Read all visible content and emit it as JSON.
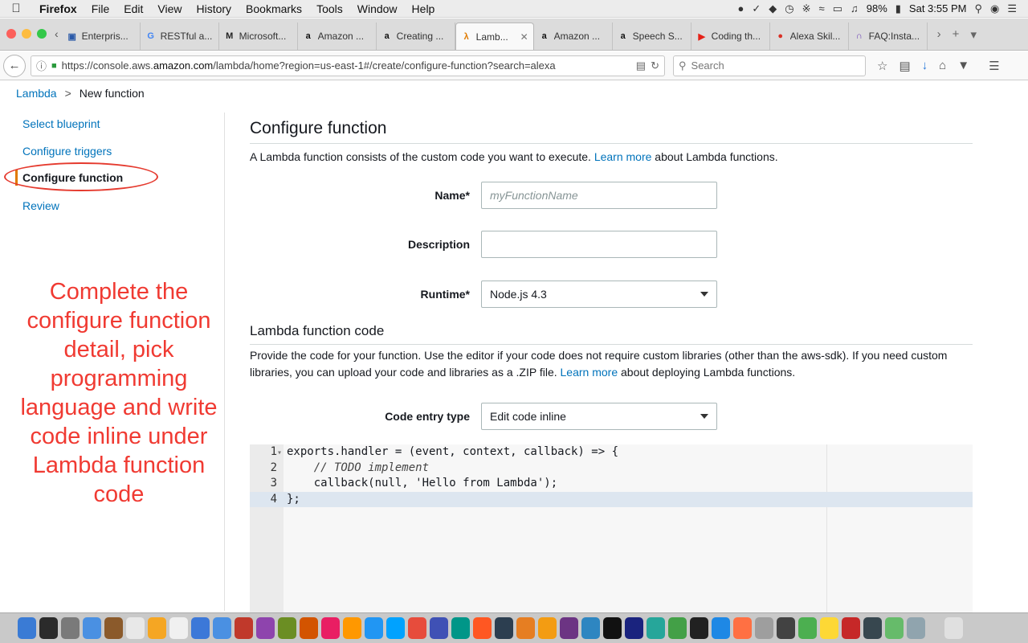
{
  "menubar": {
    "app": "Firefox",
    "items": [
      "File",
      "Edit",
      "View",
      "History",
      "Bookmarks",
      "Tools",
      "Window",
      "Help"
    ],
    "battery": "98%",
    "clock": "Sat 3:55 PM"
  },
  "tabs": [
    {
      "label": "Enterpris...",
      "icon": "page-icon",
      "color": "#2b5aa8",
      "active": false
    },
    {
      "label": "RESTful a...",
      "icon": "google-icon",
      "color": "#4285f4",
      "active": false
    },
    {
      "label": "Microsoft...",
      "icon": "microsoft-icon",
      "color": "#222222",
      "active": false
    },
    {
      "label": "Amazon ...",
      "icon": "amazon-icon",
      "color": "#111111",
      "active": false
    },
    {
      "label": "Creating ...",
      "icon": "amazon-icon",
      "color": "#111111",
      "active": false
    },
    {
      "label": "Lamb...",
      "icon": "aws-lambda-icon",
      "color": "#e07b00",
      "active": true
    },
    {
      "label": "Amazon ...",
      "icon": "amazon-icon",
      "color": "#111111",
      "active": false
    },
    {
      "label": "Speech S...",
      "icon": "amazon-icon",
      "color": "#111111",
      "active": false
    },
    {
      "label": "Coding th...",
      "icon": "youtube-icon",
      "color": "#e62117",
      "active": false
    },
    {
      "label": "Alexa Skil...",
      "icon": "microphone-icon",
      "color": "#d93025",
      "active": false
    },
    {
      "label": "FAQ:Insta...",
      "icon": "headphones-icon",
      "color": "#6a3fb5",
      "active": false
    }
  ],
  "navbar": {
    "url_prefix": "https://console.aws.",
    "url_domain": "amazon.com",
    "url_suffix": "/lambda/home?region=us-east-1#/create/configure-function?search=alexa",
    "search_placeholder": "Search"
  },
  "breadcrumb": {
    "root": "Lambda",
    "sep": ">",
    "current": "New function"
  },
  "steps": [
    {
      "label": "Select blueprint",
      "current": false
    },
    {
      "label": "Configure triggers",
      "current": false
    },
    {
      "label": "Configure function",
      "current": true
    },
    {
      "label": "Review",
      "current": false
    }
  ],
  "annotation": "Complete the configure function detail, pick programming language and write code inline under Lambda function code",
  "main": {
    "title": "Configure function",
    "desc_pre": "A Lambda function consists of the custom code you want to execute. ",
    "desc_link": "Learn more",
    "desc_post": " about Lambda functions.",
    "name_label": "Name*",
    "name_placeholder": "myFunctionName",
    "description_label": "Description",
    "description_value": "",
    "runtime_label": "Runtime*",
    "runtime_value": "Node.js 4.3",
    "code_title": "Lambda function code",
    "code_desc_pre": "Provide the code for your function. Use the editor if your code does not require custom libraries (other than the aws-sdk). If you need custom libraries, you can upload your code and libraries as a .ZIP file. ",
    "code_desc_link": "Learn more",
    "code_desc_post": " about deploying Lambda functions.",
    "entry_label": "Code entry type",
    "entry_value": "Edit code inline"
  },
  "code_lines": [
    {
      "n": "1",
      "text": "exports.handler = (event, context, callback) => {"
    },
    {
      "n": "2",
      "text": "    // TODO implement"
    },
    {
      "n": "3",
      "text": "    callback(null, 'Hello from Lambda');"
    },
    {
      "n": "4",
      "text": "};"
    }
  ],
  "colors": {
    "link": "#0073bb",
    "annotation": "#f03a32",
    "accent": "#e07b00"
  }
}
